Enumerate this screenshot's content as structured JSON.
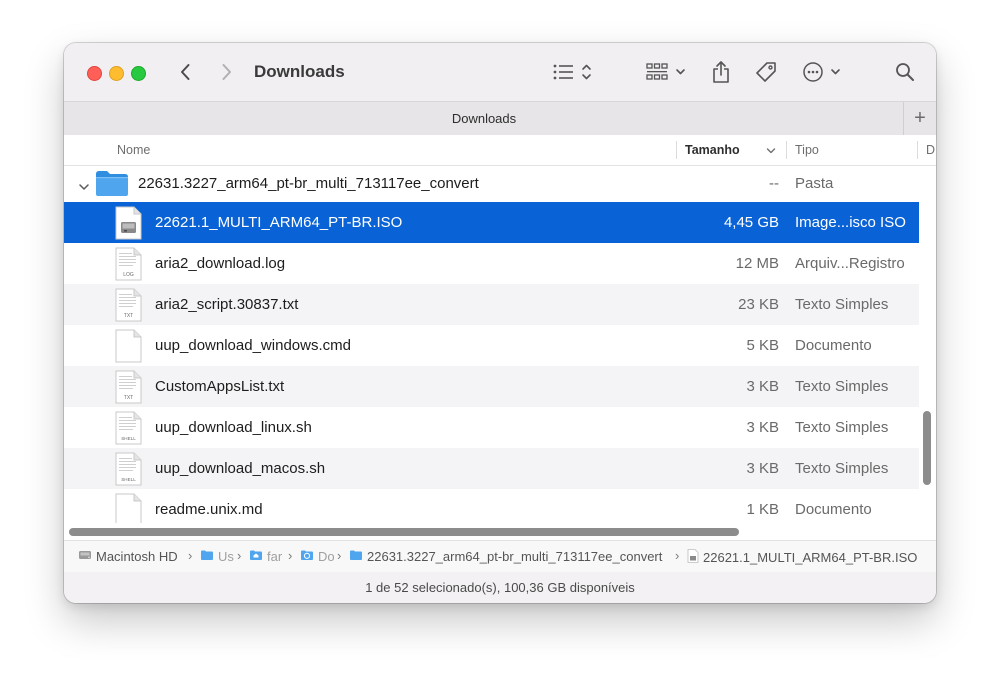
{
  "window": {
    "title": "Downloads",
    "tab_label": "Downloads",
    "tab_add": "+"
  },
  "icons": {
    "back": "chevron-left-icon",
    "forward": "chevron-right-icon",
    "list_view": "list-view-icon",
    "group": "group-icon",
    "share": "share-icon",
    "tag": "tag-icon",
    "more": "more-icon",
    "search": "search-icon"
  },
  "columns": {
    "name": "Nome",
    "size": "Tamanho",
    "kind": "Tipo",
    "extra": "D"
  },
  "folder": {
    "name": "22631.3227_arm64_pt-br_multi_713117ee_convert",
    "size": "--",
    "kind": "Pasta"
  },
  "files": [
    {
      "name": "22621.1_MULTI_ARM64_PT-BR.ISO",
      "size": "4,45 GB",
      "kind": "Image...isco ISO",
      "icon": "disk-image-icon",
      "badge": ""
    },
    {
      "name": "aria2_download.log",
      "size": "12 MB",
      "kind": "Arquiv...Registro",
      "icon": "log-file-icon",
      "badge": "LOG"
    },
    {
      "name": "aria2_script.30837.txt",
      "size": "23 KB",
      "kind": "Texto Simples",
      "icon": "text-file-icon",
      "badge": "TXT"
    },
    {
      "name": "uup_download_windows.cmd",
      "size": "5 KB",
      "kind": "Documento",
      "icon": "document-icon",
      "badge": ""
    },
    {
      "name": "CustomAppsList.txt",
      "size": "3 KB",
      "kind": "Texto Simples",
      "icon": "text-file-icon",
      "badge": "TXT"
    },
    {
      "name": "uup_download_linux.sh",
      "size": "3 KB",
      "kind": "Texto Simples",
      "icon": "shell-file-icon",
      "badge": "SHELL"
    },
    {
      "name": "uup_download_macos.sh",
      "size": "3 KB",
      "kind": "Texto Simples",
      "icon": "shell-file-icon",
      "badge": "SHELL"
    },
    {
      "name": "readme.unix.md",
      "size": "1 KB",
      "kind": "Documento",
      "icon": "document-icon",
      "badge": ""
    }
  ],
  "path": [
    {
      "label": "Macintosh HD",
      "icon": "hard-drive-icon"
    },
    {
      "label": "Us",
      "icon": "folder-icon"
    },
    {
      "label": "far",
      "icon": "home-folder-icon"
    },
    {
      "label": "Do",
      "icon": "downloads-folder-icon"
    },
    {
      "label": "22631.3227_arm64_pt-br_multi_713117ee_convert",
      "icon": "folder-icon"
    },
    {
      "label": "22621.1_MULTI_ARM64_PT-BR.ISO",
      "icon": "disk-image-icon"
    }
  ],
  "status": "1 de 52 selecionado(s), 100,36 GB disponíveis",
  "colors": {
    "selection": "#0a63d6",
    "folder": "#3d9ae8",
    "close": "#ff5f57",
    "minimize": "#febc2e",
    "zoom": "#28c840"
  }
}
